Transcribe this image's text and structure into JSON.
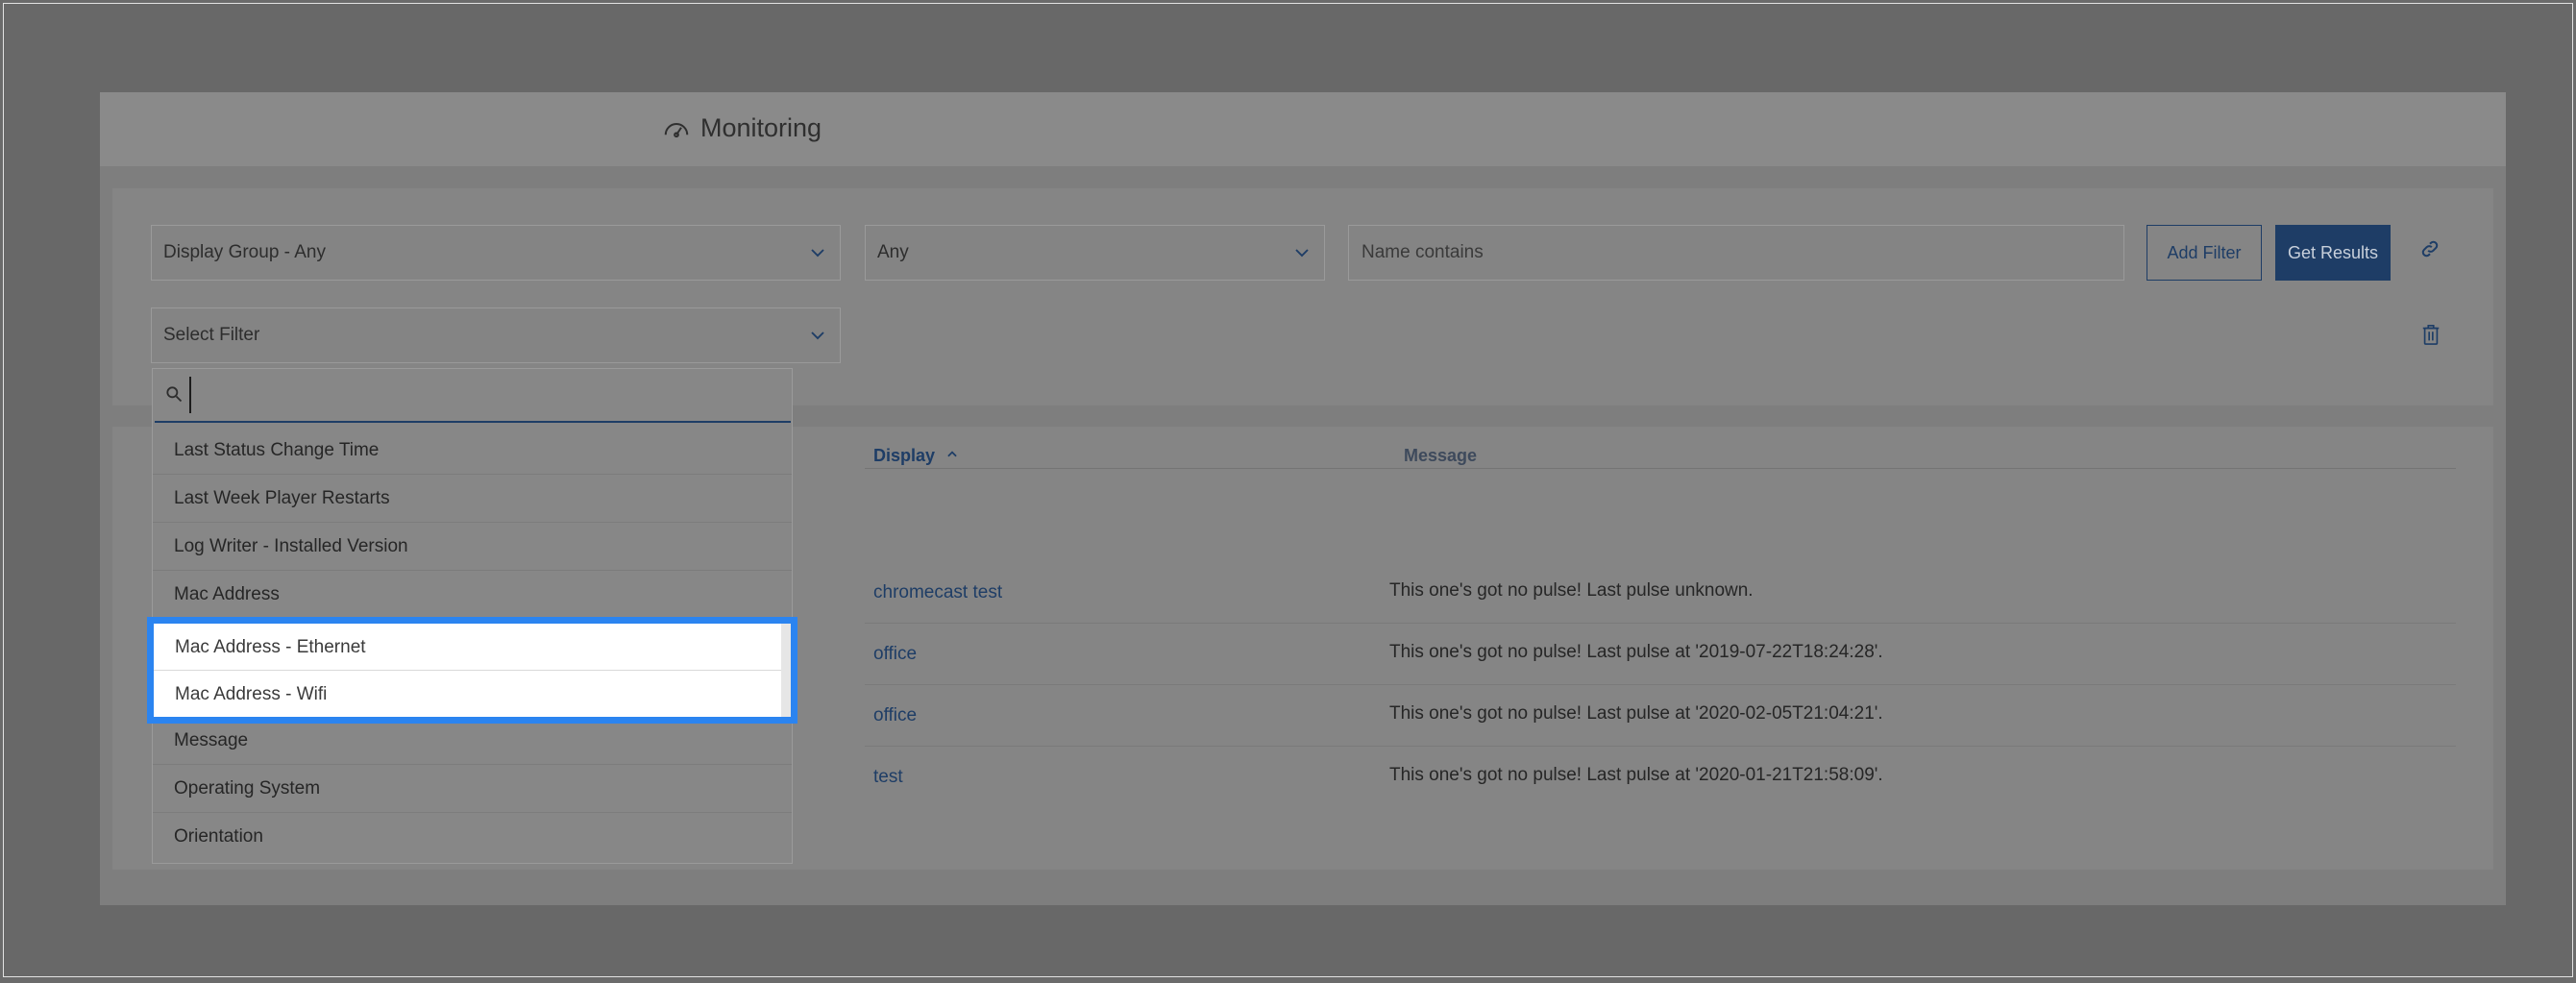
{
  "page": {
    "title": "Monitoring"
  },
  "filters": {
    "display_group": "Display Group - Any",
    "status": "Any",
    "name_placeholder": "Name contains",
    "add_filter_label": "Add Filter",
    "get_results_label": "Get Results",
    "select_filter": "Select Filter"
  },
  "dropdown": {
    "search_value": "",
    "options": [
      "Last Status Change Time",
      "Last Week Player Restarts",
      "Log Writer - Installed Version",
      "Mac Address",
      "Mac Address - Ethernet",
      "Mac Address - Wifi",
      "Message",
      "Operating System",
      "Orientation"
    ]
  },
  "table": {
    "columns": {
      "display": "Display",
      "message": "Message"
    },
    "rows": [
      {
        "display": "chromecast test",
        "message": "This one's got no pulse! Last pulse unknown."
      },
      {
        "display": "office",
        "message": "This one's got no pulse! Last pulse at '2019-07-22T18:24:28'."
      },
      {
        "display": "office",
        "message": "This one's got no pulse! Last pulse at '2020-02-05T21:04:21'."
      },
      {
        "display": "test",
        "message": "This one's got no pulse! Last pulse at '2020-01-21T21:58:09'."
      }
    ]
  },
  "colors": {
    "accent": "#1e3d66",
    "highlight": "#2b84f0"
  }
}
